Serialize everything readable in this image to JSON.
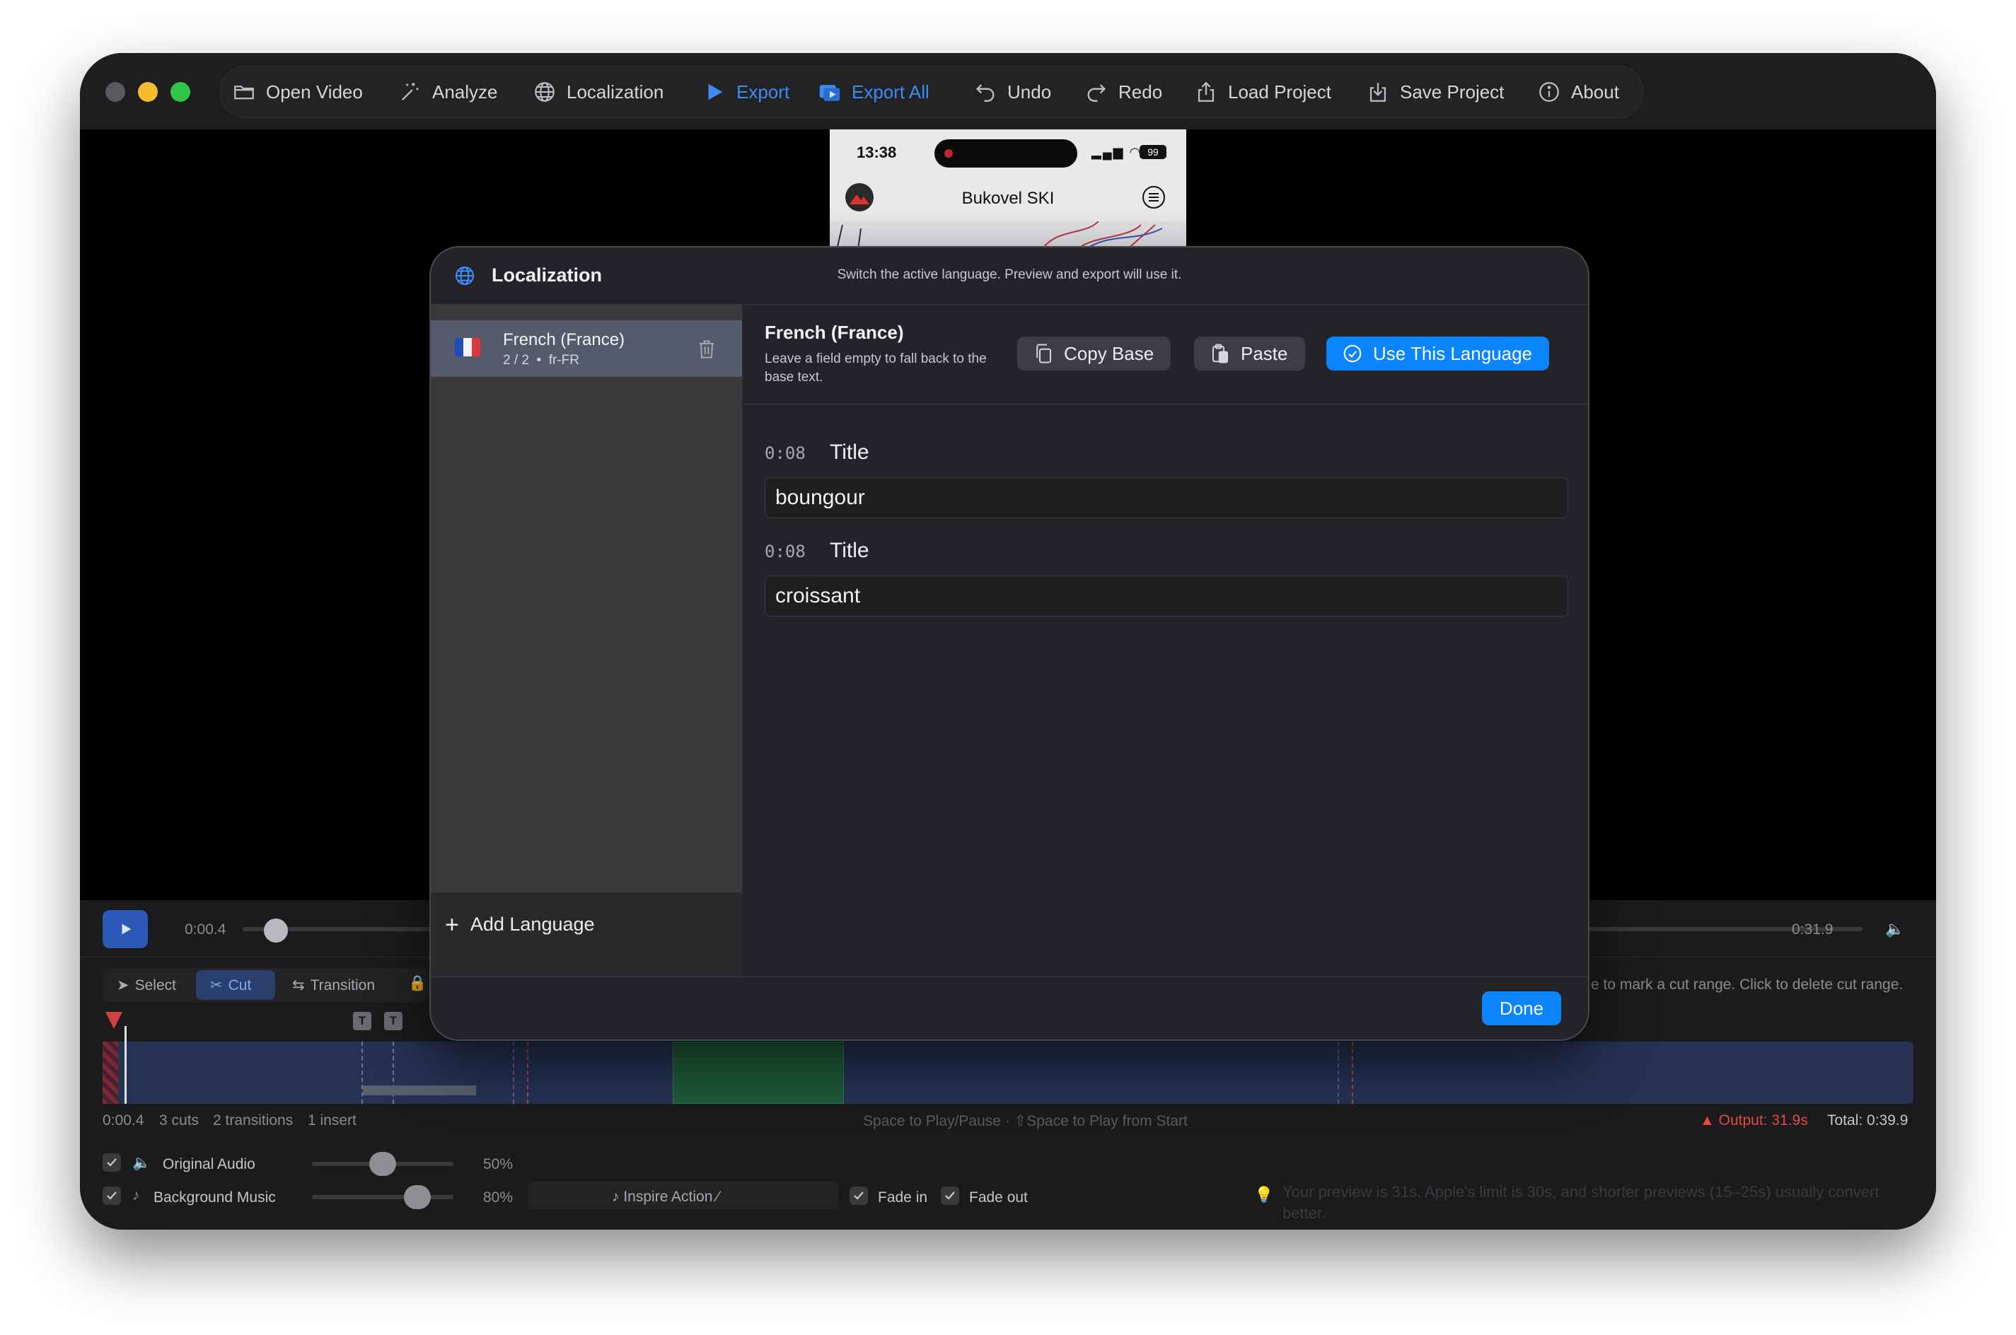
{
  "toolbar": {
    "items": [
      {
        "label": "Open Video",
        "icon": "folder-icon"
      },
      {
        "label": "Analyze",
        "icon": "magic-wand-icon"
      },
      {
        "label": "Localization",
        "icon": "globe-icon"
      },
      {
        "label": "Export",
        "icon": "play-icon"
      },
      {
        "label": "Export All",
        "icon": "export-all-icon"
      },
      {
        "label": "Undo",
        "icon": "undo-icon"
      },
      {
        "label": "Redo",
        "icon": "redo-icon"
      },
      {
        "label": "Load Project",
        "icon": "upload-icon"
      },
      {
        "label": "Save Project",
        "icon": "download-icon"
      },
      {
        "label": "About",
        "icon": "info-icon"
      }
    ],
    "accent": "#3d8bf5"
  },
  "preview": {
    "time": "13:38",
    "battery": "99",
    "app_title": "Bukovel SKI"
  },
  "modal": {
    "title": "Localization",
    "subtitle": "Switch the active language. Preview and export will use it.",
    "languages": [
      {
        "name": "French (France)",
        "meta": "2 / 2  •  fr-FR",
        "flag": "french-flag-icon"
      }
    ],
    "add_language": "Add Language",
    "detail": {
      "heading": "French (France)",
      "hint": "Leave a field empty to fall back to the base text.",
      "copy_base": "Copy Base",
      "paste": "Paste",
      "use_language": "Use This Language",
      "entries": [
        {
          "time": "0:08",
          "kind": "Title",
          "value": "boungour"
        },
        {
          "time": "0:08",
          "kind": "Title",
          "value": "croissant"
        }
      ]
    },
    "done": "Done",
    "primary_color": "#0a84ff"
  },
  "player": {
    "current": "0:00.4",
    "duration": "0:31.9"
  },
  "timeline": {
    "tools": [
      "Select",
      "Cut",
      "Transition"
    ],
    "active_tool": "Cut",
    "hint": "e to mark a cut range. Click to delete cut range.",
    "stats": {
      "time": "0:00.4",
      "cuts": "3 cuts",
      "transitions": "2 transitions",
      "inserts": "1 insert"
    },
    "shortcut_hint": "Space to Play/Pause · ⇧Space to Play from Start",
    "output": "Output: 31.9s",
    "total": "Total: 0:39.9",
    "warning_color": "#e5483f"
  },
  "audio": {
    "original": {
      "label": "Original Audio",
      "value": "50%",
      "level": 0.5
    },
    "music": {
      "label": "Background Music",
      "value": "80%",
      "level": 0.8
    },
    "track": "Inspire Action",
    "fade_in": "Fade in",
    "fade_out": "Fade out",
    "advice": "Your preview is 31s. Apple's limit is 30s, and shorter previews (15–25s) usually convert better."
  }
}
